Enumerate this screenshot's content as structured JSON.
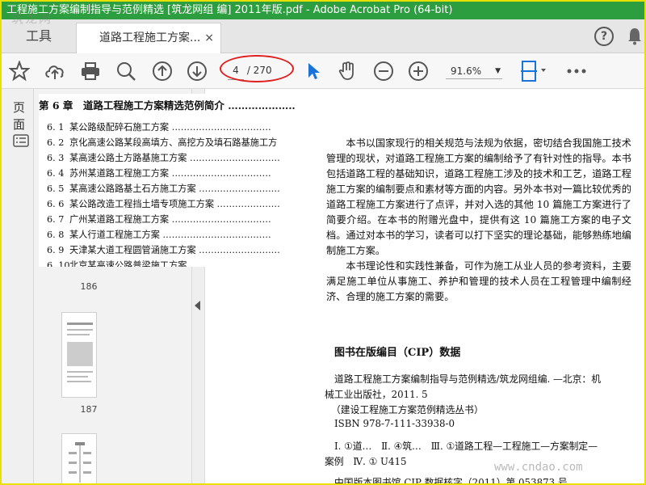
{
  "window": {
    "title": "工程施工方案编制指导与范例精选 [筑龙网组 编] 2011年版.pdf - Adobe Acrobat Pro (64-bit)"
  },
  "watermark_logo": "筑龙网",
  "tabs": {
    "tools": "工具",
    "document": "道路工程施工方案...",
    "close": "×"
  },
  "toolbar": {
    "current_page": "4",
    "total_pages": "/ 270",
    "zoom": "91.6%",
    "help": "?"
  },
  "left_panel": {
    "label": "页面"
  },
  "thumbnails": [
    {
      "num": "186"
    },
    {
      "num": "187"
    }
  ],
  "toc": {
    "heading": "第 6 章　道路工程施工方案精选范例简介 ……………………",
    "items": [
      {
        "no": "6. 1",
        "text": "某公路级配碎石施工方案 ……………………………"
      },
      {
        "no": "6. 2",
        "text": "京化高速公路某段高填方、高挖方及填石路基施工方"
      },
      {
        "no": "6. 3",
        "text": "某高速公路土方路基施工方案 …………………………"
      },
      {
        "no": "6. 4",
        "text": "苏州某道路工程施工方案 ……………………………"
      },
      {
        "no": "6. 5",
        "text": "某高速公路路基土石方施工方案 ………………………"
      },
      {
        "no": "6. 6",
        "text": "某公路改造工程挡土墙专项施工方案 …………………"
      },
      {
        "no": "6. 7",
        "text": "广州某道路工程施工方案 ……………………………"
      },
      {
        "no": "6. 8",
        "text": "某人行道工程施工方案 ………………………………"
      },
      {
        "no": "6. 9",
        "text": "天津某大道工程圆管涵施工方案 ………………………"
      },
      {
        "no": "6. 10",
        "text": "北京某高速公路普梁施工方案 …………………………"
      }
    ]
  },
  "document": {
    "para1": "本书以国家现行的相关规范与法规为依据，密切结合我国施工技术管理的现状，对道路工程施工方案的编制给予了有针对性的指导。本书包括道路工程的基础知识，道路工程施工涉及的技术和工艺，道路工程施工方案的编制要点和素材等方面的内容。另外本书对一篇比较优秀的道路工程施工方案进行了点评，并对入选的其他 10 篇施工方案进行了简要介绍。在本书的附赠光盘中，提供有这 10 篇施工方案的电子文档。通过对本书的学习，读者可以打下坚实的理论基础，能够熟练地编制施工方案。",
    "para2": "本书理论性和实践性兼备，可作为施工从业人员的参考资料，主要满足施工单位从事施工、养护和管理的技术人员在工程管理中编制经济、合理的施工方案的需要。",
    "cip_title": "图书在版编目（CIP）数据",
    "cip_line1": "道路工程施工方案编制指导与范例精选/筑龙网组编. —北京：机",
    "cip_line2": "械工业出版社，2011. 5",
    "cip_line3": "（建设工程施工方案范例精选丛书）",
    "cip_line4": "ISBN 978-7-111-33938-0",
    "cip_line5": "Ⅰ. ①道…　Ⅱ. ④筑…　Ⅲ. ①道路工程—工程施工—方案制定—",
    "cip_line6": "案例　Ⅳ. ① U415",
    "cip_line7": "中国版本图书馆 CIP 数据核字（2011）第 053873 号"
  },
  "site_watermark": "www.cndao.com",
  "colors": {
    "titlebar": "#2d9e3f",
    "highlight": "#e02020",
    "border": "#e8e000",
    "select_tool": "#1a73d9"
  }
}
